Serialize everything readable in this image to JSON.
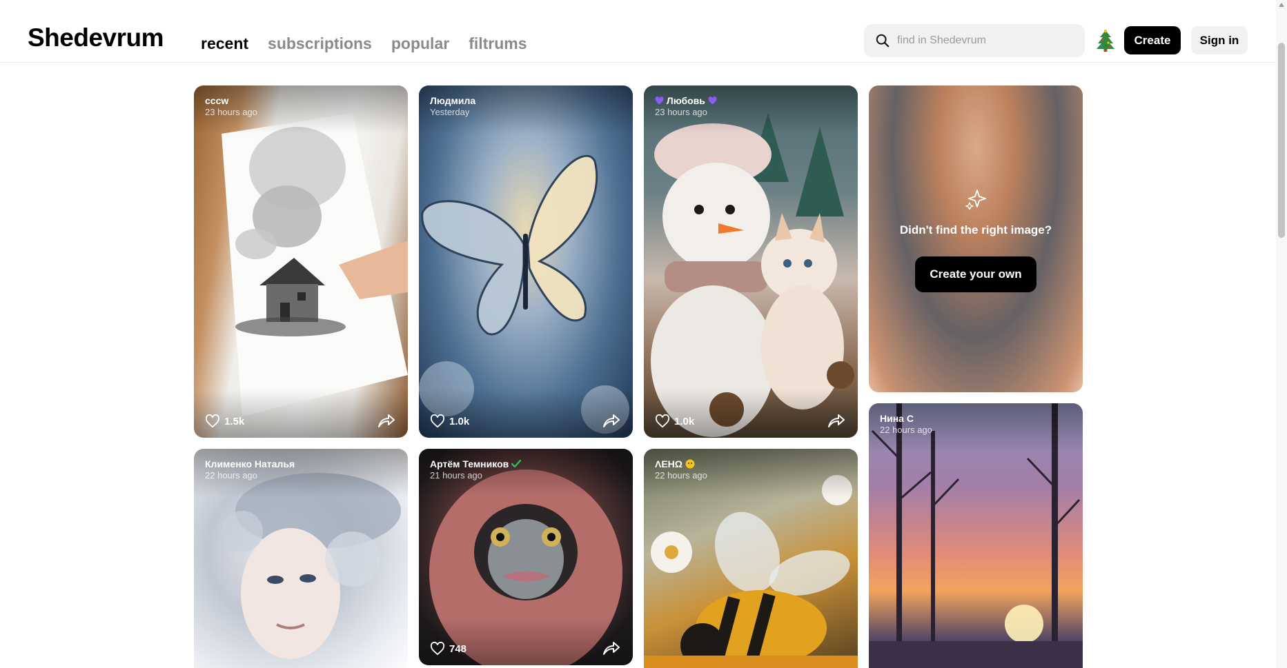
{
  "header": {
    "logo": "Shedevrum",
    "nav": [
      {
        "label": "recent",
        "active": true
      },
      {
        "label": "subscriptions",
        "active": false
      },
      {
        "label": "popular",
        "active": false
      },
      {
        "label": "filtrums",
        "active": false
      }
    ],
    "search": {
      "placeholder": "find in Shedevrum",
      "value": "",
      "icon": "search-icon"
    },
    "holiday_icon": "christmas-tree-icon",
    "create_label": "Create",
    "signin_label": "Sign in"
  },
  "cards": [
    {
      "author": "cccw",
      "time": "23 hours ago",
      "likes": "1.5k"
    },
    {
      "author": "Людмила",
      "time": "Yesterday",
      "likes": "1.0k"
    },
    {
      "author": "Любовь",
      "time": "23 hours ago",
      "likes": "1.0k",
      "badges": [
        "purple-heart-icon",
        "purple-heart-icon"
      ]
    },
    {
      "author": "Клименко Наталья",
      "time": "22 hours ago"
    },
    {
      "author": "Артём Темников",
      "time": "21 hours ago",
      "likes": "748",
      "badges": [
        "verified-check-icon"
      ]
    },
    {
      "author": "ΛЕНΩ",
      "time": "22 hours ago",
      "badges": [
        "emoji-icon"
      ]
    },
    {
      "author": "Нина С",
      "time": "22 hours ago"
    }
  ],
  "promo": {
    "icon": "sparkle-icon",
    "text": "Didn't find the right image?",
    "button_label": "Create your own"
  },
  "colors": {
    "brand": "#000000",
    "nav_inactive": "#8a8a8a",
    "search_bg": "#f1f1f1",
    "badge_purple": "#8b5cf6",
    "verified_green": "#22c55e"
  }
}
